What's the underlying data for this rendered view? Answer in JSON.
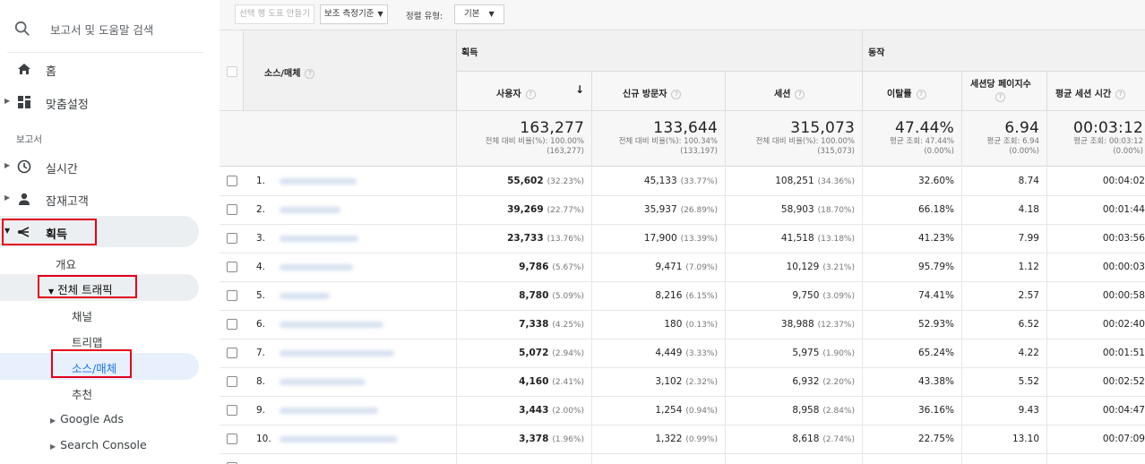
{
  "sidebar": {
    "search_placeholder": "보고서 및 도움말 검색",
    "home": "홈",
    "customization": "맞춤설정",
    "reports_section": "보고서",
    "realtime": "실시간",
    "audience": "잠재고객",
    "acquisition": "획득",
    "overview": "개요",
    "all_traffic": "전체 트래픽",
    "channels": "채널",
    "treemaps": "트리맵",
    "source_medium": "소스/매체",
    "referrals": "추천",
    "google_ads": "Google Ads",
    "search_console": "Search Console"
  },
  "toolbar": {
    "create_pivot": "선택 행 도표 만들기",
    "secondary_dimension": "보조 측정기준",
    "sort_type_label": "정렬 유형:",
    "sort_type_value": "기본"
  },
  "table": {
    "dimension_header": "소스/매체",
    "group_acquisition": "획득",
    "group_behavior": "동작",
    "columns": [
      "사용자",
      "신규 방문자",
      "세션",
      "이탈률",
      "세션당 페이지수",
      "평균 세션 시간"
    ],
    "totals": [
      {
        "value": "163,277",
        "line1": "전체 대비 비율(%): 100.00%",
        "line2": "(163,277)"
      },
      {
        "value": "133,644",
        "line1": "전체 대비 비율(%): 100.34%",
        "line2": "(133,197)"
      },
      {
        "value": "315,073",
        "line1": "전체 대비 비율(%): 100.00%",
        "line2": "(315,073)"
      },
      {
        "value": "47.44%",
        "line1": "평균 조회: 47.44%",
        "line2": "(0.00%)"
      },
      {
        "value": "6.94",
        "line1": "평균 조회: 6.94",
        "line2": "(0.00%)"
      },
      {
        "value": "00:03:12",
        "line1": "평균 조회: 00:03:12",
        "line2": "(0.00%)"
      }
    ],
    "rows": [
      {
        "idx": "1.",
        "users": "55,602",
        "users_pct": "(32.23%)",
        "new": "45,133",
        "new_pct": "(33.77%)",
        "sessions": "108,251",
        "sessions_pct": "(34.36%)",
        "bounce": "32.60%",
        "pages": "8.74",
        "duration": "00:04:02"
      },
      {
        "idx": "2.",
        "users": "39,269",
        "users_pct": "(22.77%)",
        "new": "35,937",
        "new_pct": "(26.89%)",
        "sessions": "58,903",
        "sessions_pct": "(18.70%)",
        "bounce": "66.18%",
        "pages": "4.18",
        "duration": "00:01:44"
      },
      {
        "idx": "3.",
        "users": "23,733",
        "users_pct": "(13.76%)",
        "new": "17,900",
        "new_pct": "(13.39%)",
        "sessions": "41,518",
        "sessions_pct": "(13.18%)",
        "bounce": "41.23%",
        "pages": "7.99",
        "duration": "00:03:56"
      },
      {
        "idx": "4.",
        "users": "9,786",
        "users_pct": "(5.67%)",
        "new": "9,471",
        "new_pct": "(7.09%)",
        "sessions": "10,129",
        "sessions_pct": "(3.21%)",
        "bounce": "95.79%",
        "pages": "1.12",
        "duration": "00:00:03"
      },
      {
        "idx": "5.",
        "users": "8,780",
        "users_pct": "(5.09%)",
        "new": "8,216",
        "new_pct": "(6.15%)",
        "sessions": "9,750",
        "sessions_pct": "(3.09%)",
        "bounce": "74.41%",
        "pages": "2.57",
        "duration": "00:00:58"
      },
      {
        "idx": "6.",
        "users": "7,338",
        "users_pct": "(4.25%)",
        "new": "180",
        "new_pct": "(0.13%)",
        "sessions": "38,988",
        "sessions_pct": "(12.37%)",
        "bounce": "52.93%",
        "pages": "6.52",
        "duration": "00:02:40"
      },
      {
        "idx": "7.",
        "users": "5,072",
        "users_pct": "(2.94%)",
        "new": "4,449",
        "new_pct": "(3.33%)",
        "sessions": "5,975",
        "sessions_pct": "(1.90%)",
        "bounce": "65.24%",
        "pages": "4.22",
        "duration": "00:01:51"
      },
      {
        "idx": "8.",
        "users": "4,160",
        "users_pct": "(2.41%)",
        "new": "3,102",
        "new_pct": "(2.32%)",
        "sessions": "6,932",
        "sessions_pct": "(2.20%)",
        "bounce": "43.38%",
        "pages": "5.52",
        "duration": "00:02:52"
      },
      {
        "idx": "9.",
        "users": "3,443",
        "users_pct": "(2.00%)",
        "new": "1,254",
        "new_pct": "(0.94%)",
        "sessions": "8,958",
        "sessions_pct": "(2.84%)",
        "bounce": "36.16%",
        "pages": "9.43",
        "duration": "00:04:47"
      },
      {
        "idx": "10.",
        "users": "3,378",
        "users_pct": "(1.96%)",
        "new": "1,322",
        "new_pct": "(0.99%)",
        "sessions": "8,618",
        "sessions_pct": "(2.74%)",
        "bounce": "22.75%",
        "pages": "13.10",
        "duration": "00:07:09"
      }
    ]
  },
  "colors": {
    "highlight_box": "#e3001b",
    "selected_item_bg": "#e8f0fe",
    "selected_link": "#1a73e8"
  }
}
